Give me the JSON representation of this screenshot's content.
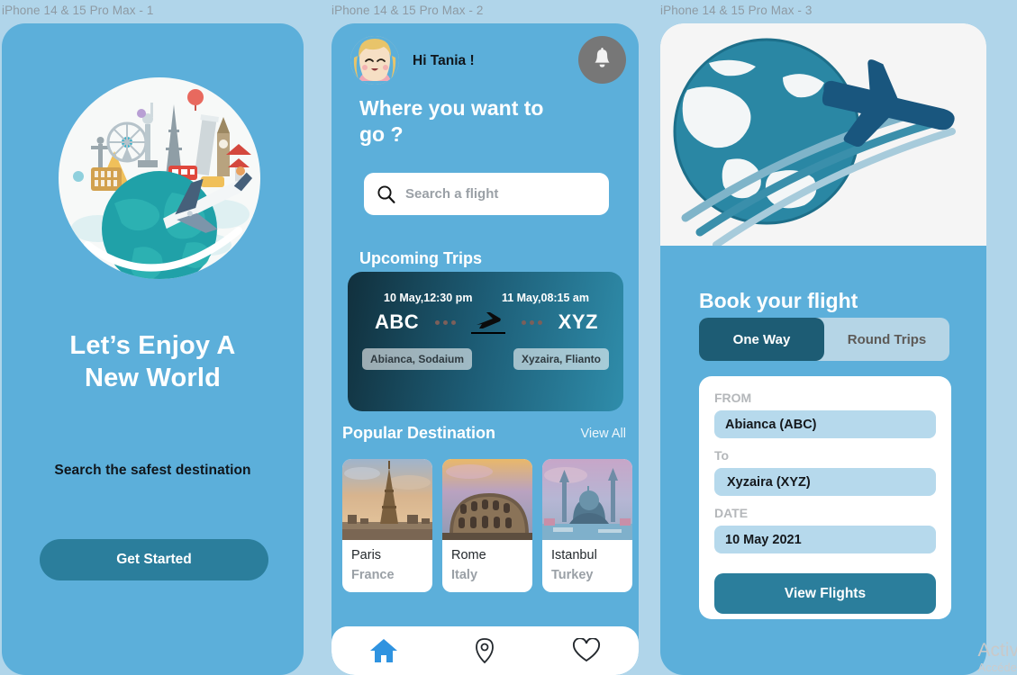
{
  "frames": [
    {
      "label": "iPhone 14 & 15 Pro Max - 1"
    },
    {
      "label": "iPhone 14 & 15 Pro Max - 2"
    },
    {
      "label": "iPhone 14 & 15 Pro Max - 3"
    }
  ],
  "colors": {
    "canvas_bg": "#b0d5ea",
    "phone_bg": "#5cafda",
    "accent_teal": "#2b7e9c",
    "dark_teal": "#1d5c74",
    "field_blue": "#b6d9ec",
    "muted_gray": "#9aa0a6"
  },
  "screen1": {
    "hero_icon": "globe-landmarks-airplane-illustration",
    "title": "Let’s Enjoy A\nNew World",
    "title_line1": "Let’s Enjoy A",
    "title_line2": "New World",
    "subtitle": "Search the safest destination",
    "cta_label": "Get Started"
  },
  "screen2": {
    "avatar": "user-avatar-illustration",
    "greeting": "Hi Tania !",
    "notification_icon": "bell-icon",
    "heading_line1": "Where you want to",
    "heading_line2": "go ?",
    "search": {
      "icon": "search-icon",
      "placeholder": "Search a flight",
      "value": ""
    },
    "upcoming_title": "Upcoming Trips",
    "trip": {
      "depart_time": "10 May,12:30 pm",
      "arrive_time": "11 May,08:15 am",
      "origin_code": "ABC",
      "destination_code": "XYZ",
      "plane_icon": "airplane-icon",
      "origin_place": "Abianca, Sodaium",
      "destination_place": "Xyzaira, Flianto"
    },
    "popular_title": "Popular Destination",
    "view_all": "View All",
    "destinations": [
      {
        "name": "Paris",
        "country": "France",
        "image": "eiffel-tower-photo"
      },
      {
        "name": "Rome",
        "country": "Italy",
        "image": "colosseum-photo"
      },
      {
        "name": "Istanbul",
        "country": "Turkey",
        "image": "blue-mosque-photo"
      }
    ],
    "nav": [
      {
        "icon": "home-icon",
        "active": true
      },
      {
        "icon": "location-pin-icon",
        "active": false
      },
      {
        "icon": "heart-icon",
        "active": false
      }
    ]
  },
  "screen3": {
    "hero_icon": "globe-with-airplane-illustration",
    "title": "Book your flight",
    "trip_types": [
      {
        "label": "One Way",
        "selected": true
      },
      {
        "label": "Round  Trips",
        "selected": false
      }
    ],
    "form": {
      "from_label": "FROM",
      "from_value": "Abianca (ABC)",
      "to_label": "To",
      "to_value": "Xyzaira (XYZ)",
      "date_label": "DATE",
      "date_value": "10 May 2021",
      "submit_label": "View Flights"
    }
  },
  "watermark": {
    "line1": "Activ",
    "line2": "Accéde"
  }
}
